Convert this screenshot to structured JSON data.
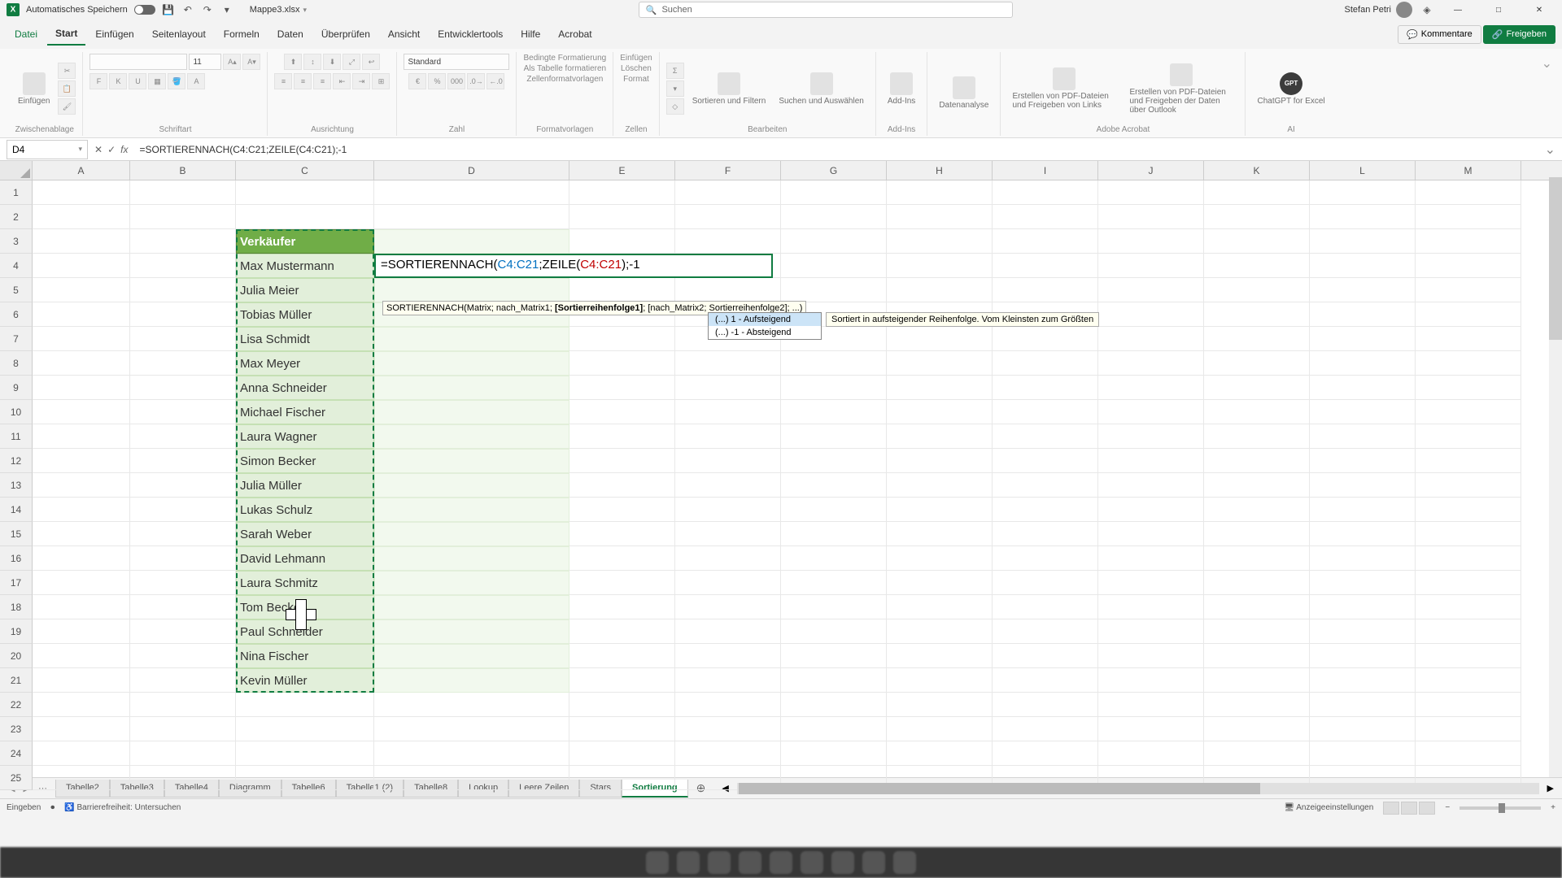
{
  "titlebar": {
    "autosave_label": "Automatisches Speichern",
    "filename": "Mappe3.xlsx",
    "search_placeholder": "Suchen",
    "username": "Stefan Petri"
  },
  "ribbon_tabs": {
    "file": "Datei",
    "start": "Start",
    "insert": "Einfügen",
    "pagelayout": "Seitenlayout",
    "formulas": "Formeln",
    "data": "Daten",
    "review": "Überprüfen",
    "view": "Ansicht",
    "developer": "Entwicklertools",
    "help": "Hilfe",
    "acrobat": "Acrobat",
    "comments": "Kommentare",
    "share": "Freigeben"
  },
  "ribbon_groups": {
    "clipboard": {
      "label": "Zwischenablage",
      "paste": "Einfügen"
    },
    "font": {
      "label": "Schriftart",
      "size": "11",
      "bold": "F",
      "italic": "K",
      "underline": "U"
    },
    "alignment": {
      "label": "Ausrichtung"
    },
    "number": {
      "label": "Zahl",
      "format": "Standard"
    },
    "styles": {
      "label": "Formatvorlagen",
      "cond": "Bedingte Formatierung",
      "table": "Als Tabelle formatieren",
      "cell": "Zellenformatvorlagen"
    },
    "cells": {
      "label": "Zellen",
      "insert": "Einfügen",
      "delete": "Löschen",
      "format": "Format"
    },
    "editing": {
      "label": "Bearbeiten",
      "sort": "Sortieren und Filtern",
      "find": "Suchen und Auswählen"
    },
    "addins": {
      "label": "Add-Ins",
      "addins_btn": "Add-Ins"
    },
    "analysis": {
      "label": "",
      "btn": "Datenanalyse"
    },
    "acrobat": {
      "label": "Adobe Acrobat",
      "btn1": "Erstellen von PDF-Dateien und Freigeben von Links",
      "btn2": "Erstellen von PDF-Dateien und Freigeben der Daten über Outlook"
    },
    "gpt": {
      "label": "AI",
      "btn": "ChatGPT for Excel"
    }
  },
  "namebox": "D4",
  "formula_bar": "=SORTIERENNACH(C4:C21;ZEILE(C4:C21);-1",
  "columns": [
    "A",
    "B",
    "C",
    "D",
    "E",
    "F",
    "G",
    "H",
    "I",
    "J",
    "K",
    "L",
    "M"
  ],
  "rows": [
    "1",
    "2",
    "3",
    "4",
    "5",
    "6",
    "7",
    "8",
    "9",
    "10",
    "11",
    "12",
    "13",
    "14",
    "15",
    "16",
    "17",
    "18",
    "19",
    "20",
    "21",
    "22",
    "23",
    "24",
    "25"
  ],
  "data": {
    "header": "Verkäufer",
    "values": [
      "Max Mustermann",
      "Julia Meier",
      "Tobias Müller",
      "Lisa Schmidt",
      "Max Meyer",
      "Anna Schneider",
      "Michael Fischer",
      "Laura Wagner",
      "Simon Becker",
      "Julia Müller",
      "Lukas Schulz",
      "Sarah Weber",
      "David Lehmann",
      "Laura Schmitz",
      "Tom Becker",
      "Paul Schneider",
      "Nina Fischer",
      "Kevin Müller"
    ]
  },
  "formula_edit": {
    "prefix": "=SORTIERENNACH(",
    "ref1": "C4:C21",
    "mid": ";ZEILE(",
    "ref2": "C4:C21",
    "suffix": ");-1"
  },
  "func_tooltip": {
    "text_before": "SORTIERENNACH(Matrix; nach_Matrix1; ",
    "active": "[Sortierreihenfolge1]",
    "text_after": "; [nach_Matrix2; Sortierreihenfolge2]; ...)"
  },
  "autocomplete": {
    "opt1": "(...) 1 - Aufsteigend",
    "opt2": "(...) -1 - Absteigend"
  },
  "desc_tooltip": "Sortiert in aufsteigender Reihenfolge. Vom Kleinsten zum Größten",
  "sheet_tabs": [
    "Tabelle2",
    "Tabelle3",
    "Tabelle4",
    "Diagramm",
    "Tabelle6",
    "Tabelle1 (2)",
    "Tabelle8",
    "Lookup",
    "Leere Zeilen",
    "Stars",
    "Sortierung"
  ],
  "active_sheet_index": 10,
  "status": {
    "mode": "Eingeben",
    "accessibility": "Barrierefreiheit: Untersuchen",
    "display_settings": "Anzeigeeinstellungen"
  }
}
